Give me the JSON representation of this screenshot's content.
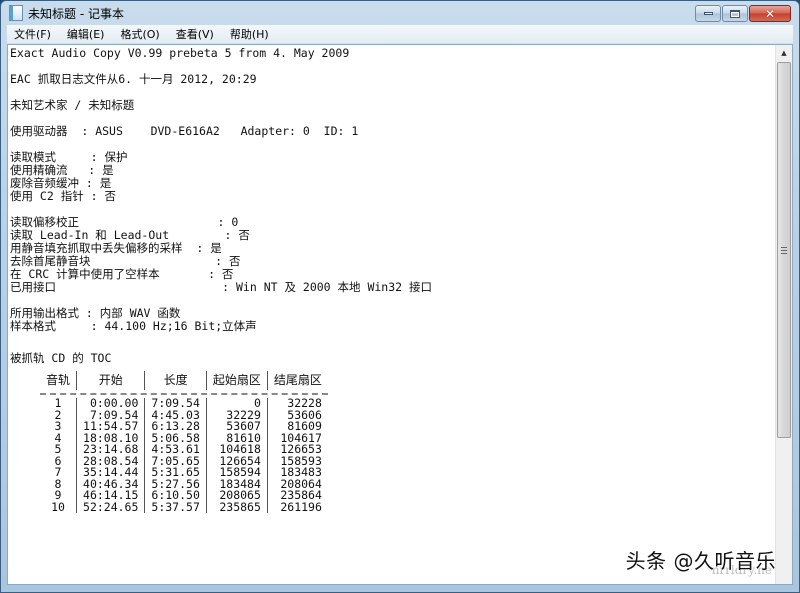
{
  "window": {
    "title": "未知标题 - 记事本",
    "icon": "notepad-icon",
    "controls": {
      "minimize": "minimize-icon",
      "maximize": "maximize-icon",
      "close": "close-icon",
      "close_glyph": "✕"
    }
  },
  "menubar": {
    "items": [
      {
        "label": "文件(F)"
      },
      {
        "label": "编辑(E)"
      },
      {
        "label": "格式(O)"
      },
      {
        "label": "查看(V)"
      },
      {
        "label": "帮助(H)"
      }
    ]
  },
  "document": {
    "header_lines": [
      "Exact Audio Copy V0.99 prebeta 5 from 4. May 2009",
      "EAC 抓取日志文件从6. 十一月 2012, 20:29",
      "未知艺术家 / 未知标题",
      "使用驱动器  : ASUS    DVD-E616A2   Adapter: 0  ID: 1"
    ],
    "settings_block_1": [
      "读取模式     : 保护",
      "使用精确流   : 是",
      "废除音频缓冲 : 是",
      "使用 C2 指针 : 否"
    ],
    "settings_block_2": [
      "读取偏移校正                    : 0",
      "读取 Lead-In 和 Lead-Out        : 否",
      "用静音填充抓取中丢失偏移的采样  : 是",
      "去除首尾静音块                  : 否",
      "在 CRC 计算中使用了空样本       : 否",
      "已用接口                        : Win NT 及 2000 本地 Win32 接口"
    ],
    "output_block": [
      "所用输出格式 : 内部 WAV 函数",
      "样本格式     : 44.100 Hz;16 Bit;立体声"
    ],
    "toc_title": "被抓轨 CD 的 TOC",
    "toc": {
      "headers": [
        "音轨",
        "开始",
        "长度",
        "起始扇区",
        "结尾扇区"
      ],
      "rows": [
        [
          "1",
          "0:00.00",
          "7:09.54",
          "0",
          "32228"
        ],
        [
          "2",
          "7:09.54",
          "4:45.03",
          "32229",
          "53606"
        ],
        [
          "3",
          "11:54.57",
          "6:13.28",
          "53607",
          "81609"
        ],
        [
          "4",
          "18:08.10",
          "5:06.58",
          "81610",
          "104617"
        ],
        [
          "5",
          "23:14.68",
          "4:53.61",
          "104618",
          "126653"
        ],
        [
          "6",
          "28:08.54",
          "7:05.65",
          "126654",
          "158593"
        ],
        [
          "7",
          "35:14.44",
          "5:31.65",
          "158594",
          "183483"
        ],
        [
          "8",
          "40:46.34",
          "5:27.56",
          "183484",
          "208064"
        ],
        [
          "9",
          "46:14.15",
          "6:10.50",
          "208065",
          "235864"
        ],
        [
          "10",
          "52:24.65",
          "5:37.57",
          "235865",
          "261196"
        ]
      ]
    }
  },
  "scrollbar": {
    "up_arrow": "▲"
  },
  "watermark": {
    "text": "头条 @久听音乐",
    "sub": "nrrldry.ne"
  }
}
